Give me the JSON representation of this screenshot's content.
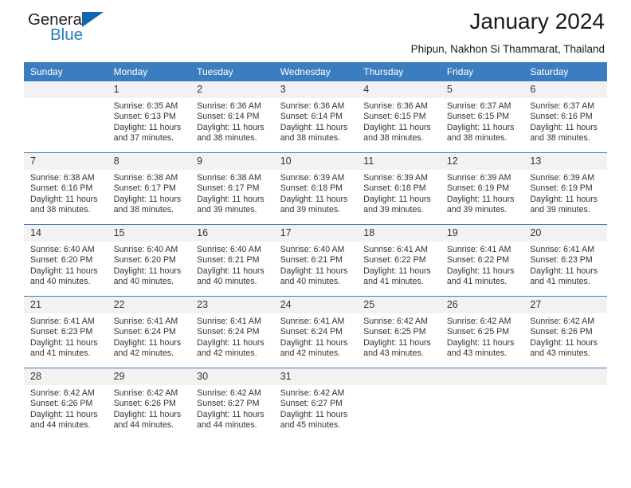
{
  "logo": {
    "word_top": "General",
    "word_bottom": "Blue",
    "triangle_icon": "triangle-icon",
    "color_dark": "#231f20",
    "color_blue": "#2281c4"
  },
  "header": {
    "title": "January 2024",
    "subtitle": "Phipun, Nakhon Si Thammarat, Thailand"
  },
  "theme": {
    "header_band": "#3b7dc0",
    "daynum_band": "#f2f2f2",
    "text": "#333333"
  },
  "calendar": {
    "weekday_headers": [
      "Sunday",
      "Monday",
      "Tuesday",
      "Wednesday",
      "Thursday",
      "Friday",
      "Saturday"
    ],
    "weeks": [
      [
        {
          "day": "",
          "sunrise": "",
          "sunset": "",
          "daylight": "",
          "blank": true
        },
        {
          "day": "1",
          "sunrise": "Sunrise: 6:35 AM",
          "sunset": "Sunset: 6:13 PM",
          "daylight": "Daylight: 11 hours and 37 minutes."
        },
        {
          "day": "2",
          "sunrise": "Sunrise: 6:36 AM",
          "sunset": "Sunset: 6:14 PM",
          "daylight": "Daylight: 11 hours and 38 minutes."
        },
        {
          "day": "3",
          "sunrise": "Sunrise: 6:36 AM",
          "sunset": "Sunset: 6:14 PM",
          "daylight": "Daylight: 11 hours and 38 minutes."
        },
        {
          "day": "4",
          "sunrise": "Sunrise: 6:36 AM",
          "sunset": "Sunset: 6:15 PM",
          "daylight": "Daylight: 11 hours and 38 minutes."
        },
        {
          "day": "5",
          "sunrise": "Sunrise: 6:37 AM",
          "sunset": "Sunset: 6:15 PM",
          "daylight": "Daylight: 11 hours and 38 minutes."
        },
        {
          "day": "6",
          "sunrise": "Sunrise: 6:37 AM",
          "sunset": "Sunset: 6:16 PM",
          "daylight": "Daylight: 11 hours and 38 minutes."
        }
      ],
      [
        {
          "day": "7",
          "sunrise": "Sunrise: 6:38 AM",
          "sunset": "Sunset: 6:16 PM",
          "daylight": "Daylight: 11 hours and 38 minutes."
        },
        {
          "day": "8",
          "sunrise": "Sunrise: 6:38 AM",
          "sunset": "Sunset: 6:17 PM",
          "daylight": "Daylight: 11 hours and 38 minutes."
        },
        {
          "day": "9",
          "sunrise": "Sunrise: 6:38 AM",
          "sunset": "Sunset: 6:17 PM",
          "daylight": "Daylight: 11 hours and 39 minutes."
        },
        {
          "day": "10",
          "sunrise": "Sunrise: 6:39 AM",
          "sunset": "Sunset: 6:18 PM",
          "daylight": "Daylight: 11 hours and 39 minutes."
        },
        {
          "day": "11",
          "sunrise": "Sunrise: 6:39 AM",
          "sunset": "Sunset: 6:18 PM",
          "daylight": "Daylight: 11 hours and 39 minutes."
        },
        {
          "day": "12",
          "sunrise": "Sunrise: 6:39 AM",
          "sunset": "Sunset: 6:19 PM",
          "daylight": "Daylight: 11 hours and 39 minutes."
        },
        {
          "day": "13",
          "sunrise": "Sunrise: 6:39 AM",
          "sunset": "Sunset: 6:19 PM",
          "daylight": "Daylight: 11 hours and 39 minutes."
        }
      ],
      [
        {
          "day": "14",
          "sunrise": "Sunrise: 6:40 AM",
          "sunset": "Sunset: 6:20 PM",
          "daylight": "Daylight: 11 hours and 40 minutes."
        },
        {
          "day": "15",
          "sunrise": "Sunrise: 6:40 AM",
          "sunset": "Sunset: 6:20 PM",
          "daylight": "Daylight: 11 hours and 40 minutes."
        },
        {
          "day": "16",
          "sunrise": "Sunrise: 6:40 AM",
          "sunset": "Sunset: 6:21 PM",
          "daylight": "Daylight: 11 hours and 40 minutes."
        },
        {
          "day": "17",
          "sunrise": "Sunrise: 6:40 AM",
          "sunset": "Sunset: 6:21 PM",
          "daylight": "Daylight: 11 hours and 40 minutes."
        },
        {
          "day": "18",
          "sunrise": "Sunrise: 6:41 AM",
          "sunset": "Sunset: 6:22 PM",
          "daylight": "Daylight: 11 hours and 41 minutes."
        },
        {
          "day": "19",
          "sunrise": "Sunrise: 6:41 AM",
          "sunset": "Sunset: 6:22 PM",
          "daylight": "Daylight: 11 hours and 41 minutes."
        },
        {
          "day": "20",
          "sunrise": "Sunrise: 6:41 AM",
          "sunset": "Sunset: 6:23 PM",
          "daylight": "Daylight: 11 hours and 41 minutes."
        }
      ],
      [
        {
          "day": "21",
          "sunrise": "Sunrise: 6:41 AM",
          "sunset": "Sunset: 6:23 PM",
          "daylight": "Daylight: 11 hours and 41 minutes."
        },
        {
          "day": "22",
          "sunrise": "Sunrise: 6:41 AM",
          "sunset": "Sunset: 6:24 PM",
          "daylight": "Daylight: 11 hours and 42 minutes."
        },
        {
          "day": "23",
          "sunrise": "Sunrise: 6:41 AM",
          "sunset": "Sunset: 6:24 PM",
          "daylight": "Daylight: 11 hours and 42 minutes."
        },
        {
          "day": "24",
          "sunrise": "Sunrise: 6:41 AM",
          "sunset": "Sunset: 6:24 PM",
          "daylight": "Daylight: 11 hours and 42 minutes."
        },
        {
          "day": "25",
          "sunrise": "Sunrise: 6:42 AM",
          "sunset": "Sunset: 6:25 PM",
          "daylight": "Daylight: 11 hours and 43 minutes."
        },
        {
          "day": "26",
          "sunrise": "Sunrise: 6:42 AM",
          "sunset": "Sunset: 6:25 PM",
          "daylight": "Daylight: 11 hours and 43 minutes."
        },
        {
          "day": "27",
          "sunrise": "Sunrise: 6:42 AM",
          "sunset": "Sunset: 6:26 PM",
          "daylight": "Daylight: 11 hours and 43 minutes."
        }
      ],
      [
        {
          "day": "28",
          "sunrise": "Sunrise: 6:42 AM",
          "sunset": "Sunset: 6:26 PM",
          "daylight": "Daylight: 11 hours and 44 minutes."
        },
        {
          "day": "29",
          "sunrise": "Sunrise: 6:42 AM",
          "sunset": "Sunset: 6:26 PM",
          "daylight": "Daylight: 11 hours and 44 minutes."
        },
        {
          "day": "30",
          "sunrise": "Sunrise: 6:42 AM",
          "sunset": "Sunset: 6:27 PM",
          "daylight": "Daylight: 11 hours and 44 minutes."
        },
        {
          "day": "31",
          "sunrise": "Sunrise: 6:42 AM",
          "sunset": "Sunset: 6:27 PM",
          "daylight": "Daylight: 11 hours and 45 minutes."
        },
        {
          "day": "",
          "sunrise": "",
          "sunset": "",
          "daylight": "",
          "blank": true
        },
        {
          "day": "",
          "sunrise": "",
          "sunset": "",
          "daylight": "",
          "blank": true
        },
        {
          "day": "",
          "sunrise": "",
          "sunset": "",
          "daylight": "",
          "blank": true
        }
      ]
    ]
  }
}
